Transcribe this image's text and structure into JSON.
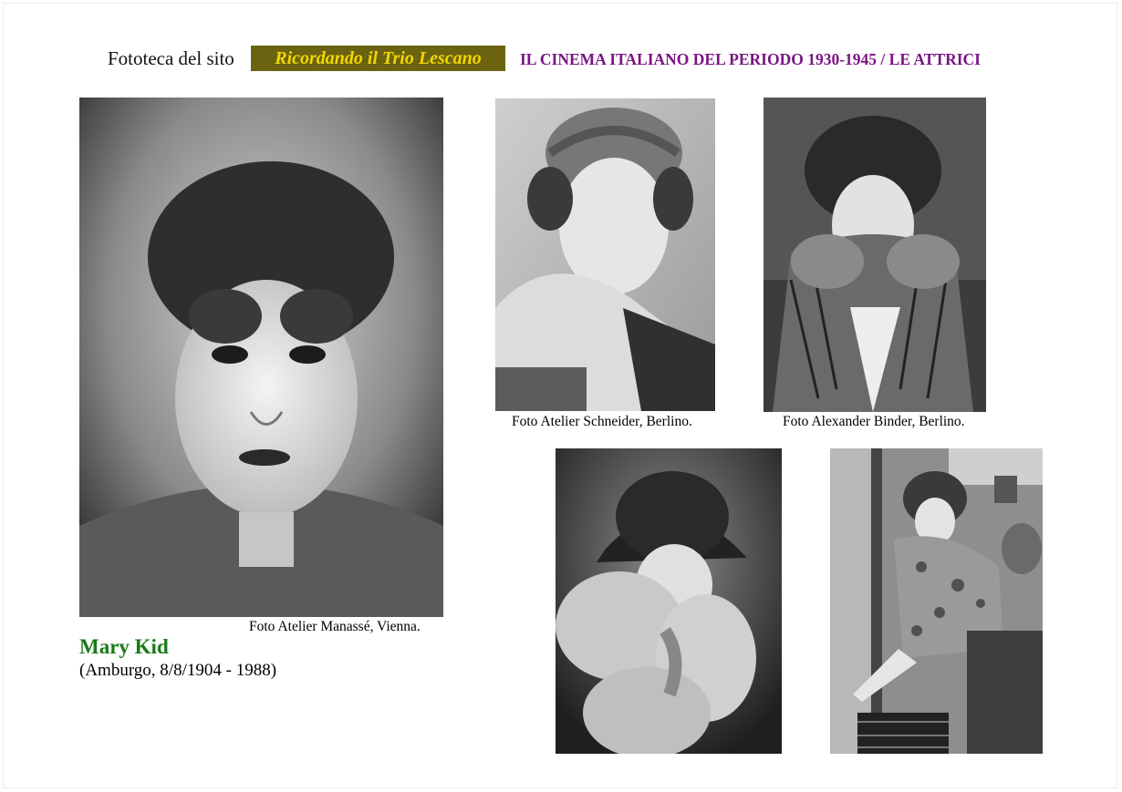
{
  "header": {
    "prefix": "Fototeca del sito",
    "site_name": "Ricordando il Trio Lescano",
    "section_title": "IL CINEMA ITALIANO DEL PERIODO 1930-1945 / LE ATTRICI"
  },
  "actress": {
    "name": "Mary Kid",
    "details": "(Amburgo, 8/8/1904 - 1988)"
  },
  "photos": [
    {
      "caption": "Foto Atelier Manassé, Vienna."
    },
    {
      "caption": "Foto Atelier Schneider, Berlino."
    },
    {
      "caption": "Foto Alexander Binder, Berlino."
    },
    {
      "caption": ""
    },
    {
      "caption": ""
    }
  ],
  "colors": {
    "badge_bg": "#6b6310",
    "badge_text": "#f3d600",
    "title": "#7a1585",
    "name": "#1a7a1a"
  }
}
